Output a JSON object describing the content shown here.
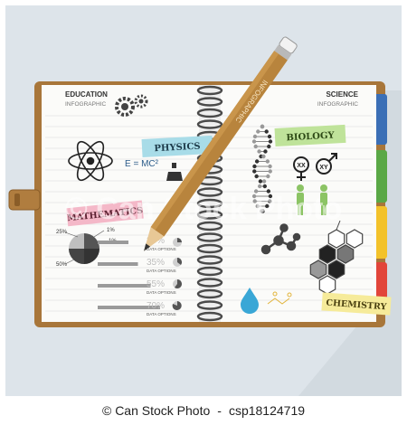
{
  "left_page": {
    "heading": "EDUCATION",
    "subheading": "INFOGRAPHIC",
    "formula": "E = MC²",
    "physics_label": "PHYSICS",
    "mathematics_label": "MATHEMATICS",
    "pie_labels": [
      "25%",
      "1%",
      "1%",
      "50%"
    ],
    "bars": [
      {
        "percent": "20%",
        "caption": "DATA OPTIONS",
        "fill": 0.2
      },
      {
        "percent": "35%",
        "caption": "DATA OPTIONS",
        "fill": 0.35
      },
      {
        "percent": "55%",
        "caption": "DATA OPTIONS",
        "fill": 0.55
      },
      {
        "percent": "70%",
        "caption": "DATA OPTIONS",
        "fill": 0.7
      }
    ]
  },
  "right_page": {
    "heading": "SCIENCE",
    "subheading": "INFOGRAPHIC",
    "biology_label": "BIOLOGY",
    "chemistry_label": "CHEMISTRY",
    "gender_labels": [
      "XX",
      "XY"
    ]
  },
  "pencil_label": "INFOGRAPHIC",
  "watermark": "© Can Stock Photo",
  "footer": {
    "copyright": "© Can Stock Photo",
    "separator": "-",
    "image_id": "csp18124719"
  },
  "colors": {
    "background": "#dde4ea",
    "notebook_cover": "#a8763a",
    "page": "#fbfbf9",
    "physics_tag": "#a8dce8",
    "mathematics_tag": "#f4b8c8",
    "biology_tag": "#bfe39a",
    "chemistry_tag": "#f6eb9a",
    "tab_blue": "#3b6fb6",
    "tab_green": "#5aa846",
    "tab_yellow": "#f3c22a",
    "tab_red": "#e2453a"
  }
}
